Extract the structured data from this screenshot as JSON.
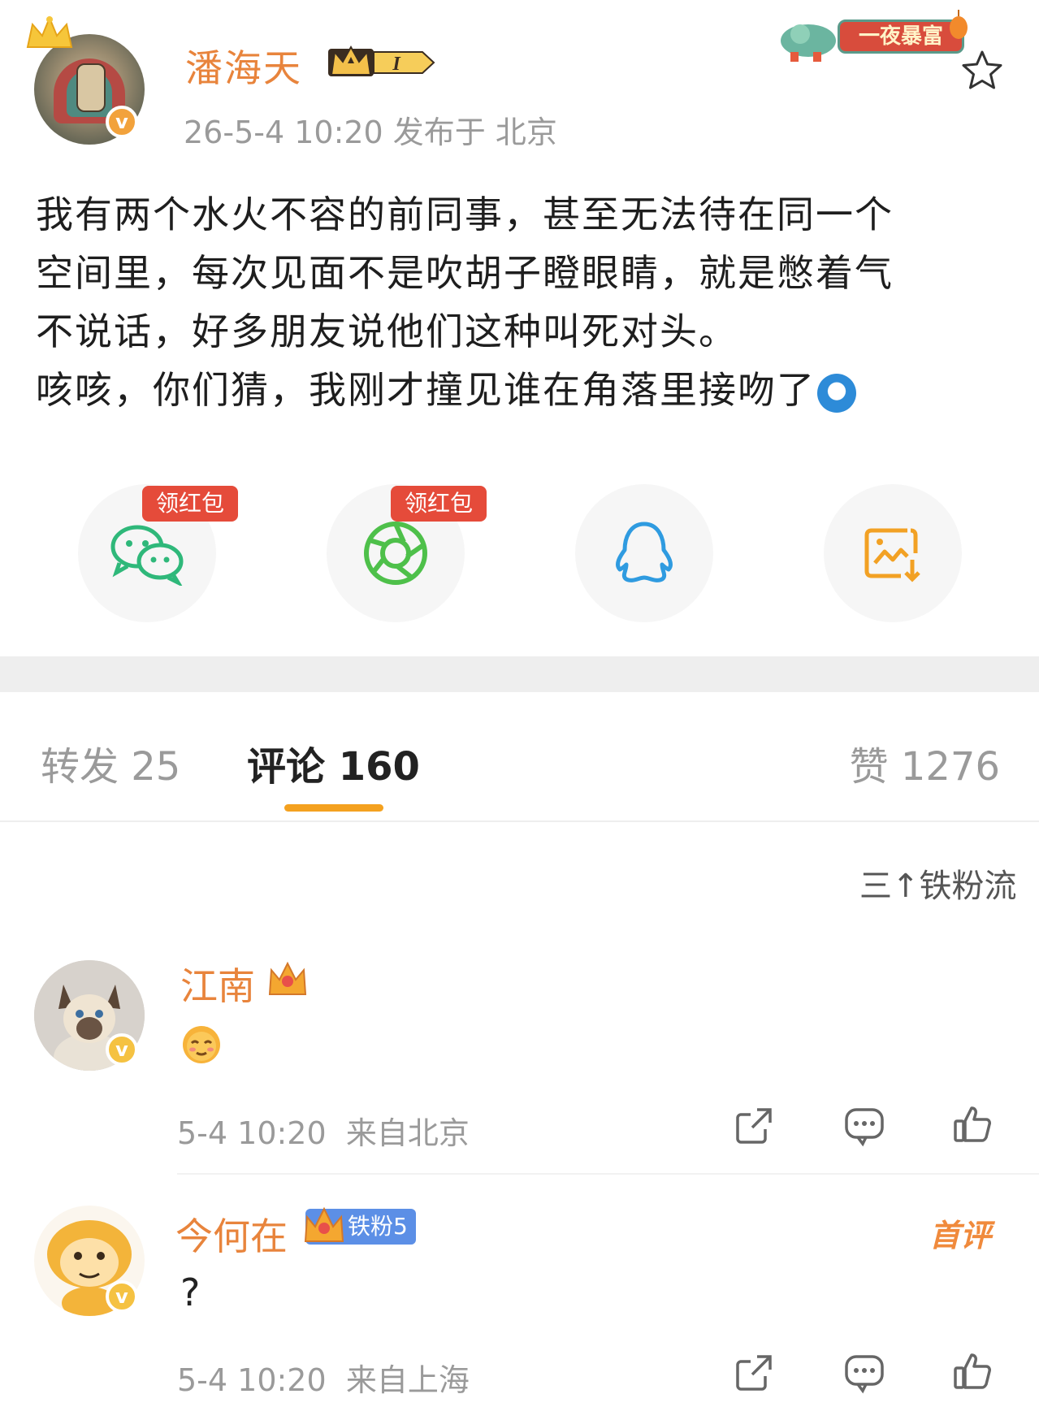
{
  "post": {
    "username": "潘海天",
    "level": "I",
    "meta": "26-5-4 10:20  发布于 北京",
    "promo": "一夜暴富",
    "verify_mark": "v",
    "body_text": "我有两个水火不容的前同事，甚至无法待在同一个\n空间里，每次见面不是吹胡子瞪眼睛，就是憋着气\n不说话，好多朋友说他们这种叫死对头。\n咳咳，你们猜，我刚才撞见谁在角落里接吻了"
  },
  "share": {
    "wechat_tag": "领红包",
    "moments_tag": "领红包"
  },
  "tabs": {
    "repost": "转发 25",
    "comment": "评论 160",
    "like": "赞 1276"
  },
  "sort_label": "铁粉流",
  "sort_icon": "三↑",
  "comments": [
    {
      "name": "江南",
      "text": "",
      "time": "5-4 10:20",
      "location": "来自北京"
    },
    {
      "name": "今何在",
      "fan_badge": "铁粉5",
      "text": "?",
      "time": "5-4 10:20",
      "location": "来自上海",
      "first_tag": "首评"
    }
  ],
  "colors": {
    "accent": "#e8843c",
    "tab_underline": "#f4a11f",
    "red_tag": "#e54b3a",
    "verify": "#f2a23c"
  }
}
